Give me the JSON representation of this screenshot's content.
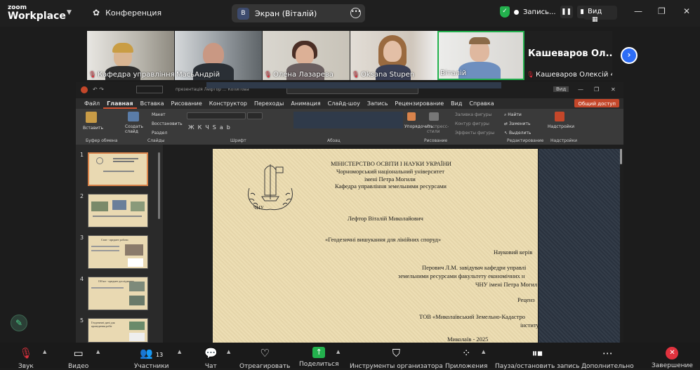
{
  "app": {
    "brand_top": "zoom",
    "brand_bottom": "Workplace"
  },
  "header": {
    "conference_label": "Конференция",
    "screen_tab_avatar": "В",
    "screen_tab_label": "Экран (Віталій)",
    "record_label": "Запись...",
    "view_label": "Вид"
  },
  "participants": [
    {
      "name": "Кафедра управління з..."
    },
    {
      "name": "МасьАндрій"
    },
    {
      "name": "Олена Лазарева"
    },
    {
      "name": "Oksana Stupen"
    },
    {
      "name": "Віталій"
    },
    {
      "name": "Кашеваров Олексій 4...",
      "big_name": "Кашеваров Ол..."
    }
  ],
  "ppt": {
    "title_bar": "презентація Лефтор ... Копитова",
    "view_btn": "Вид",
    "menu": [
      "Файл",
      "Главная",
      "Вставка",
      "Рисование",
      "Конструктор",
      "Переходы",
      "Анимация",
      "Слайд-шоу",
      "Запись",
      "Рецензирование",
      "Вид",
      "Справка"
    ],
    "share_button": "Общий доступ",
    "ribbon": {
      "paste": "Вставить",
      "create_slide": "Создать слайд",
      "layout": "Макет",
      "restore": "Восстановить",
      "section": "Раздел",
      "group_clipboard": "Буфер обмена",
      "group_slides": "Слайды",
      "group_font": "Шрифт",
      "group_paragraph": "Абзац",
      "group_drawing": "Рисование",
      "group_editing": "Редактирование",
      "group_addins": "Надстройки",
      "shape_fill": "Заливка фигуры",
      "shape_outline": "Контур фигуры",
      "shape_effects": "Эффекты фигуры",
      "arrange": "Упорядочить",
      "quick_styles": "Экспресс-стили",
      "find": "Найти",
      "replace": "Заменить",
      "select": "Выделить",
      "addins": "Надстройки"
    },
    "thumbs": [
      "1",
      "2",
      "3",
      "4",
      "5"
    ],
    "thumb_texts": {
      "t3": "Стан - предмет роботи",
      "t4": "Об'єкт - предмет дослідження",
      "t5": "Геодезичні дані для проведення робіт"
    },
    "slide": {
      "l1": "МІНІСТЕРСТВО ОСВІТИ І НАУКИ УКРАЇНИ",
      "l2": "Чорноморський національний університет",
      "l3": "імені Петра Могили",
      "l4": "Кафедра управління земельними ресурсами",
      "author": "Лефтор Віталій Миколайович",
      "topic": "«Геодезичні вишукання для лінійних споруд»",
      "advisor_label": "Науковий керів",
      "advisor1": "Перович Л.М. завідувач кафедри управлі",
      "advisor2": "земельними ресурсами факультету економічних н",
      "advisor3": "ЧНУ імені Петра Могил",
      "reviewer_label": "Реценз",
      "reviewer1": "ТОВ «Миколаївський Земельно-Кадастро",
      "reviewer2": "інститу",
      "city": "Миколаїв - 2025",
      "logo_text": "ЧНУ"
    }
  },
  "toolbar": {
    "sound": "Звук",
    "video": "Видео",
    "participants": "Участники",
    "participants_count": "13",
    "chat": "Чат",
    "react": "Отреагировать",
    "share": "Поделиться",
    "host_tools": "Инструменты организатора",
    "apps": "Приложения",
    "pause_record": "Пауза/остановить запись",
    "more": "Дополнительно",
    "end": "Завершение"
  },
  "colors": {
    "accent_blue": "#2d6df6",
    "share_green": "#23b14d",
    "end_red": "#e0323e",
    "ppt_orange": "#d35230"
  }
}
